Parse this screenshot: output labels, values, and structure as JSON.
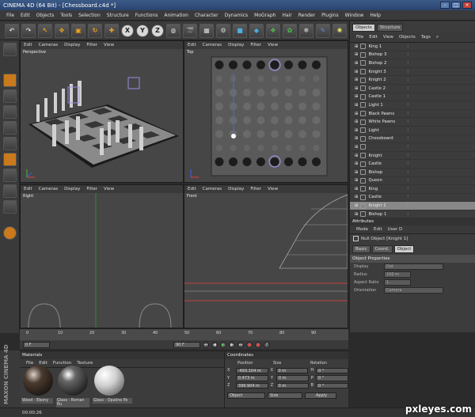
{
  "title": "CINEMA 4D (64 Bit) - [Chessboard.c4d *]",
  "menu": [
    "File",
    "Edit",
    "Objects",
    "Tools",
    "Selection",
    "Structure",
    "Functions",
    "Animation",
    "Character",
    "Dynamics",
    "MoGraph",
    "Hair",
    "Render",
    "Plugins",
    "Window",
    "Help"
  ],
  "viewport_menu": [
    "Edit",
    "Cameras",
    "Display",
    "Filter",
    "View"
  ],
  "viewports": {
    "perspective": "Perspective",
    "top": "Top",
    "right": "Right",
    "front": "Front"
  },
  "objects_panel": {
    "tabs": [
      "Objects",
      "Structure"
    ],
    "menu": [
      "File",
      "Edit",
      "View",
      "Objects",
      "Tags"
    ],
    "items": [
      "King 1",
      "Bishop 3",
      "Bishop 2",
      "Knight 3",
      "Knight 2",
      "Castle 2",
      "Castle 1",
      "Light 1",
      "Black Pawns",
      "White Pawns",
      "Light",
      "Chessboard",
      "",
      "Knight",
      "Castle",
      "Bishop",
      "Queen",
      "King",
      "Castle",
      "Knight 1",
      "Bishop 1"
    ],
    "selected_index": 19
  },
  "attributes_panel": {
    "menu": [
      "Mode",
      "Edit",
      "User D"
    ],
    "header": "Attributes",
    "object_title": "Null Object [Knight 1]",
    "tabs": [
      "Basic",
      "Coord.",
      "Object"
    ],
    "section": "Object Properties",
    "fields": [
      {
        "label": "Display",
        "value": "Dot"
      },
      {
        "label": "Radius",
        "value": "100 m"
      },
      {
        "label": "Aspect Ratio",
        "value": "1"
      },
      {
        "label": "Orientation",
        "value": "Camera"
      }
    ]
  },
  "timeline": {
    "ticks": [
      "0",
      "10",
      "20",
      "30",
      "40",
      "50",
      "60",
      "70",
      "80",
      "90"
    ],
    "current_frame": "0 F",
    "end_frame": "90 F",
    "start_field": "0 F",
    "max_field": "90 F"
  },
  "materials": {
    "header": "Materials",
    "menu": [
      "File",
      "Edit",
      "Function",
      "Texture"
    ],
    "items": [
      "Wood - Ebony",
      "Glass - Roman Ru",
      "Glass - Opaline Po"
    ]
  },
  "coordinates": {
    "header": "Coordinates",
    "columns": [
      "Position",
      "Size",
      "Rotation"
    ],
    "rows": [
      {
        "axis": "X",
        "position": "-493.104 m",
        "size": "0 m",
        "rot_axis": "H",
        "rotation": "0 °"
      },
      {
        "axis": "Y",
        "position": "0.473 m",
        "size": "0 m",
        "rot_axis": "P",
        "rotation": "0 °"
      },
      {
        "axis": "Z",
        "position": "399.904 m",
        "size": "0 m",
        "rot_axis": "B",
        "rotation": "0 °"
      }
    ],
    "mode": "Object",
    "size_mode": "Size",
    "apply": "Apply"
  },
  "statusbar": "00:00:26",
  "brand": "MAXON CINEMA 4D",
  "watermark": "pxleyes.com"
}
